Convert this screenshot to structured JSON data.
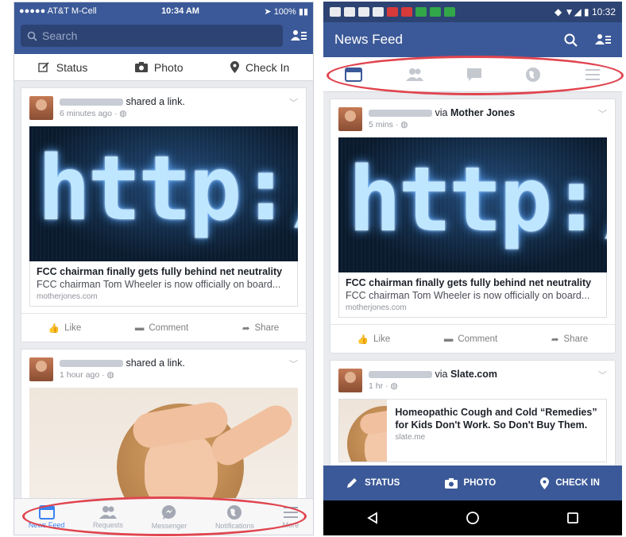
{
  "ios": {
    "status": {
      "carrier": "●●●●● AT&T M-Cell",
      "time": "10:34 AM",
      "battery": "100%"
    },
    "search": {
      "placeholder": "Search"
    },
    "composer": {
      "status": "Status",
      "photo": "Photo",
      "checkin": "Check In"
    },
    "posts": [
      {
        "action": "shared a link.",
        "time": "6 minutes ago ·",
        "link": {
          "image_text": "http://",
          "title": "FCC chairman finally gets fully behind net neutrality",
          "desc": "FCC chairman Tom Wheeler is now officially on board...",
          "source": "motherjones.com"
        },
        "actions": {
          "like": "Like",
          "comment": "Comment",
          "share": "Share"
        }
      },
      {
        "action": "shared a link.",
        "time": "1 hour ago ·"
      }
    ],
    "tabs": [
      {
        "label": "News Feed",
        "icon": "news-feed-icon"
      },
      {
        "label": "Requests",
        "icon": "requests-icon"
      },
      {
        "label": "Messenger",
        "icon": "messenger-icon"
      },
      {
        "label": "Notifications",
        "icon": "globe-icon"
      },
      {
        "label": "More",
        "icon": "menu-icon"
      }
    ]
  },
  "android": {
    "status": {
      "time": "10:32"
    },
    "title": "News Feed",
    "posts": [
      {
        "via_prefix": "via",
        "via": "Mother Jones",
        "time": "5 mins ·",
        "link": {
          "image_text": "http://",
          "title": "FCC chairman finally gets fully behind net neutrality",
          "desc": "FCC chairman Tom Wheeler is now officially on board...",
          "source": "motherjones.com"
        },
        "actions": {
          "like": "Like",
          "comment": "Comment",
          "share": "Share"
        }
      },
      {
        "via_prefix": "via",
        "via": "Slate.com",
        "time": "1 hr ·",
        "link": {
          "title": "Homeopathic Cough and Cold “Remedies” for Kids Don't Work. So Don't Buy Them.",
          "source": "slate.me"
        }
      }
    ],
    "bottom": {
      "status": "STATUS",
      "photo": "PHOTO",
      "checkin": "CHECK IN"
    }
  },
  "colors": {
    "fb_blue": "#3b5998",
    "highlight_oval": "#e0454f",
    "ios_active_tab": "#3b82f0"
  }
}
